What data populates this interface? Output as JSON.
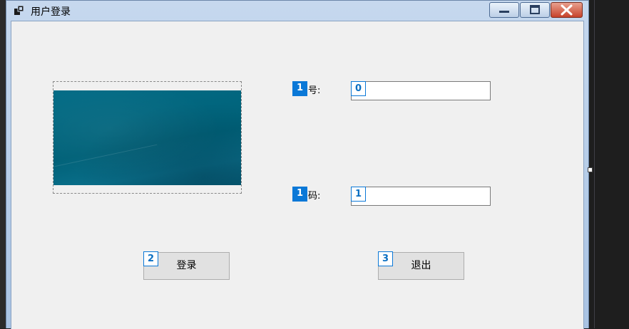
{
  "window": {
    "title": "用户登录"
  },
  "form": {
    "account_label_visible": "号:",
    "password_label_visible": "码:",
    "account_value": "",
    "password_value": "",
    "login_button": "登录",
    "exit_button": "退出"
  },
  "tab_indices": {
    "account_label": "1",
    "password_label": "1",
    "account_input": "0",
    "password_input": "1",
    "login_button": "2",
    "exit_button": "3"
  },
  "icons": {
    "app": "app-window-icon",
    "minimize": "minimize-icon",
    "maximize": "maximize-icon",
    "close": "close-icon"
  },
  "colors": {
    "badge_blue": "#0a78d7",
    "close_red": "#c7432c",
    "picture_teal": "#006178"
  }
}
